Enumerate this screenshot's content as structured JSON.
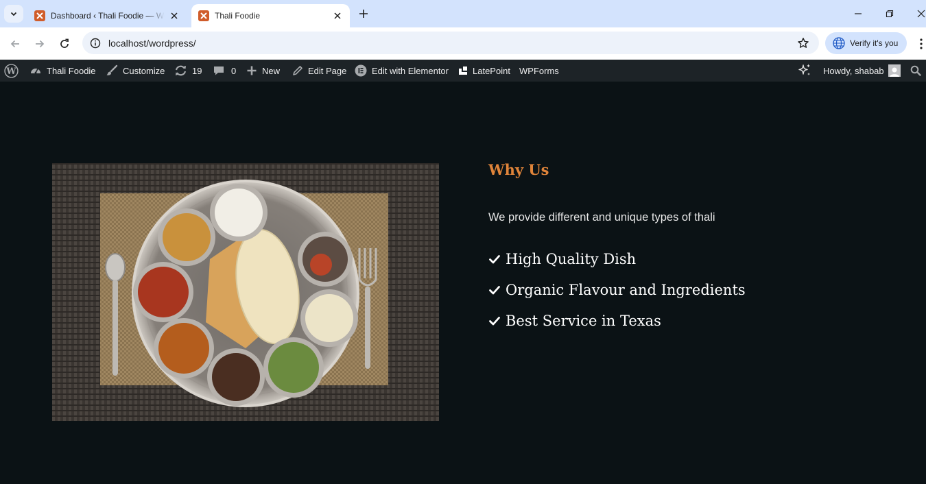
{
  "browser": {
    "tabs": [
      {
        "title": "Dashboard ‹ Thali Foodie — WordPress",
        "active": false
      },
      {
        "title": "Thali Foodie",
        "active": true
      }
    ],
    "url": "localhost/wordpress/",
    "verify_label": "Verify it's you"
  },
  "admin_bar": {
    "site_name": "Thali Foodie",
    "customize": "Customize",
    "updates_count": "19",
    "comments_count": "0",
    "new": "New",
    "edit_page": "Edit Page",
    "edit_elementor": "Edit with Elementor",
    "latepoint": "LatePoint",
    "wpforms": "WPForms",
    "howdy": "Howdy, shabab"
  },
  "section": {
    "heading": "Why Us",
    "description": "We provide different and unique types of thali",
    "features": [
      "High Quality Dish",
      "Organic Flavour and Ingredients",
      "Best Service in Texas"
    ]
  },
  "colors": {
    "page_background": "#0b1215",
    "heading_accent": "#e0843a",
    "admin_bar": "#1d2327",
    "tab_strip": "#d3e3fd"
  }
}
